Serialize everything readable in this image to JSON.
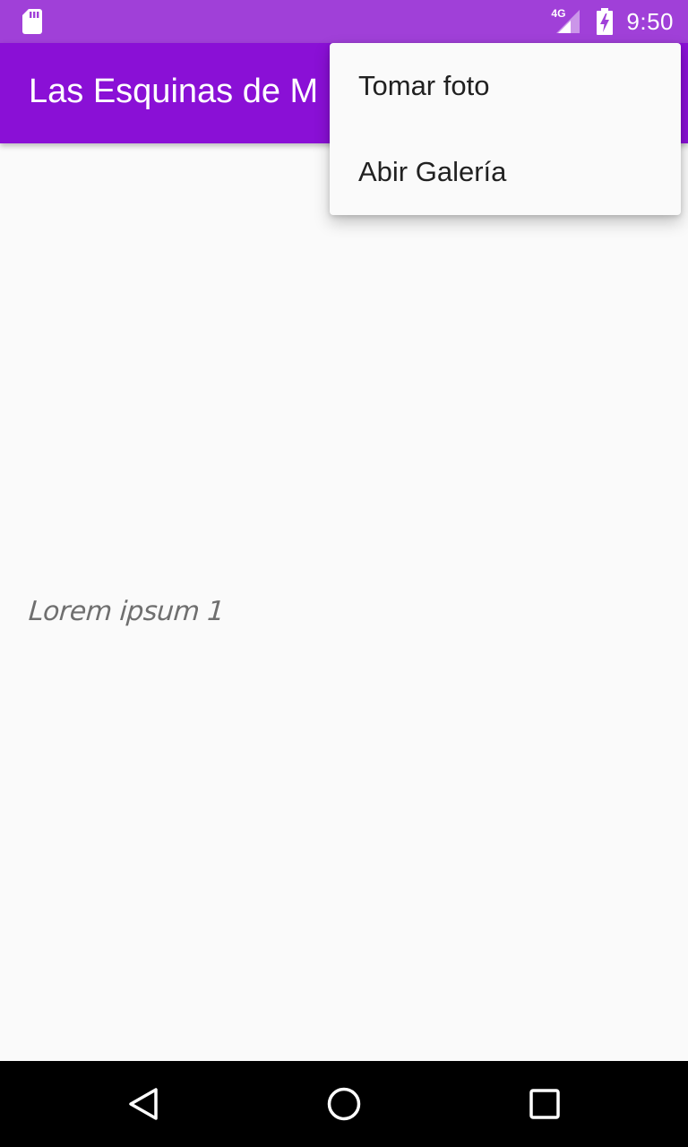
{
  "status_bar": {
    "time": "9:50",
    "network": "4G",
    "icons": [
      "sd-card-icon",
      "signal-icon",
      "battery-charging-icon"
    ]
  },
  "app_bar": {
    "title": "Las Esquinas de M"
  },
  "content": {
    "text": "Lorem ipsum 1"
  },
  "popup_menu": {
    "items": [
      {
        "label": "Tomar foto"
      },
      {
        "label": "Abir Galería"
      }
    ]
  },
  "nav_bar": {
    "icons": [
      "back-icon",
      "home-icon",
      "recents-icon"
    ]
  },
  "colors": {
    "status_bar": "#a040d8",
    "app_bar": "#8a10d6",
    "background": "#fafafa",
    "menu_text": "#212121"
  }
}
